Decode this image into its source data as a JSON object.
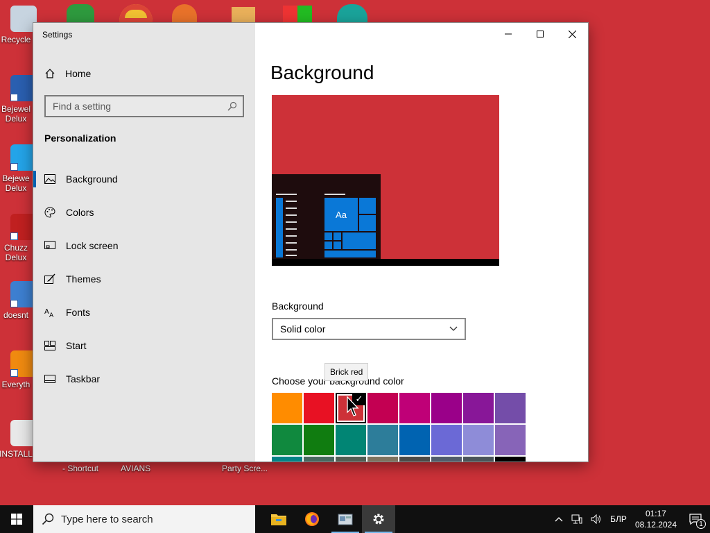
{
  "desktop": {
    "icons": [
      {
        "label": "Recycle",
        "color": "#c7d4e0"
      },
      {
        "label": "Bejewel Delux",
        "color": "#2a5fb0"
      },
      {
        "label": "Bejewe Delux",
        "color": "#24a4e8"
      },
      {
        "label": "Chuzz Delux",
        "color": "#c02020"
      },
      {
        "label": "doesnt",
        "color": "#3d7fd0"
      },
      {
        "label": "Everyth",
        "color": "#f08a10"
      },
      {
        "label": "INSTALL",
        "color": "#e8e8e8"
      }
    ],
    "bottom_labels": [
      "- Shortcut",
      "AVIANS",
      "Party Scre..."
    ]
  },
  "window": {
    "title": "Settings",
    "home_label": "Home",
    "search_placeholder": "Find a setting",
    "section_title": "Personalization",
    "nav_items": [
      {
        "label": "Background",
        "icon": "picture-icon"
      },
      {
        "label": "Colors",
        "icon": "palette-icon"
      },
      {
        "label": "Lock screen",
        "icon": "lock-screen-icon"
      },
      {
        "label": "Themes",
        "icon": "themes-icon"
      },
      {
        "label": "Fonts",
        "icon": "fonts-icon"
      },
      {
        "label": "Start",
        "icon": "start-icon"
      },
      {
        "label": "Taskbar",
        "icon": "taskbar-icon"
      }
    ],
    "active_item": "Background"
  },
  "main": {
    "page_title": "Background",
    "preview": {
      "tile_text": "Aa",
      "background_color": "#cd3138",
      "accent_color": "#0a78d7"
    },
    "background_label": "Background",
    "background_value": "Solid color",
    "choose_label": "Choose your background color",
    "tooltip": "Brick red",
    "selected_color_index": 2,
    "colors": [
      "#ff8c00",
      "#e81123",
      "#cd3138",
      "#c30052",
      "#bf0077",
      "#9a0089",
      "#881798",
      "#744da9",
      "#10893e",
      "#107c10",
      "#018574",
      "#2d7d9a",
      "#0063b1",
      "#6b69d6",
      "#8e8cd8",
      "#8764b8",
      "#038387",
      "#486860",
      "#525e54",
      "#7e735f",
      "#4c4a48",
      "#515c6b",
      "#4a5459",
      "#000000"
    ]
  },
  "taskbar": {
    "search_placeholder": "Type here to search",
    "language": "БЛР",
    "time": "01:17",
    "date": "08.12.2024",
    "notification_count": "1"
  }
}
